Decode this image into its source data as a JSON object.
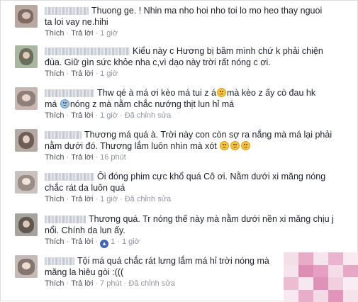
{
  "comments": [
    {
      "line1": "Thuong ge. ! Nhin ma nho hoi nho toi lo mo heo thay nguoi",
      "cont": [
        "ta loi vay ne.hihi"
      ],
      "like": "Thích",
      "reply": "Trả lời",
      "time": "1 giờ",
      "edited": ""
    },
    {
      "line1": "Kiểu này c Hương bị bầm mình chứ k phải chiện",
      "cont": [
        "đùa. Giữ gìn sức khỏe nha c,vì dạo này trời rất nóng c ơi."
      ],
      "like": "Thích",
      "reply": "Trả lời",
      "time": "1 giờ",
      "edited": ""
    },
    {
      "line1": "Thw qé à má ơi kèo má tui z á",
      "line1_after": "mà kèo z ấy cò đau hk",
      "cont_a": "má",
      "cont_b": "nóng z mà nằm chắc nướng thịt lun hỉ má",
      "like": "Thích",
      "reply": "Trả lời",
      "time": "1 giờ",
      "edited": "Đã chỉnh sửa"
    },
    {
      "line1": "Thương má quá à. Trời này con còn sợ ra nắng mà má lại phải",
      "cont": [
        "nằm dưới đó. Thương lắm luôn nhìn mà xót"
      ],
      "like": "Thích",
      "reply": "Trả lời",
      "time": "16 phút",
      "edited": ""
    },
    {
      "line1": "Ôi đóng phim cực khổ quá Cô ơi. Nằm dưới xi măng nóng",
      "cont": [
        "chắc rát da luôn quá"
      ],
      "like": "Thích",
      "reply": "Trả lời",
      "time": "1 giờ",
      "edited": "Đã chỉnh sửa"
    },
    {
      "line1": "Thương quá. Tr nóng thế này mà nằm dưới nền xi măng chịu j",
      "cont": [
        "nổi. Chính da lun ấy."
      ],
      "like": "Thích",
      "reply": "Trả lời",
      "time": "1 giờ",
      "edited": "",
      "likes": "1"
    },
    {
      "line1": "Tội má quá chắc rát lưng lắm má hỉ trời nóng mà",
      "cont": [
        "măng la hiêu gòi :((("
      ],
      "like": "Thích",
      "reply": "Trả lời",
      "time": "7 phút",
      "edited": "Đã chỉnh sửa"
    }
  ],
  "sep": "·",
  "colors": {
    "meta": "#90949c",
    "text": "#1d2129",
    "like_badge": "#4267b2",
    "emoji": "#f7c33e"
  }
}
